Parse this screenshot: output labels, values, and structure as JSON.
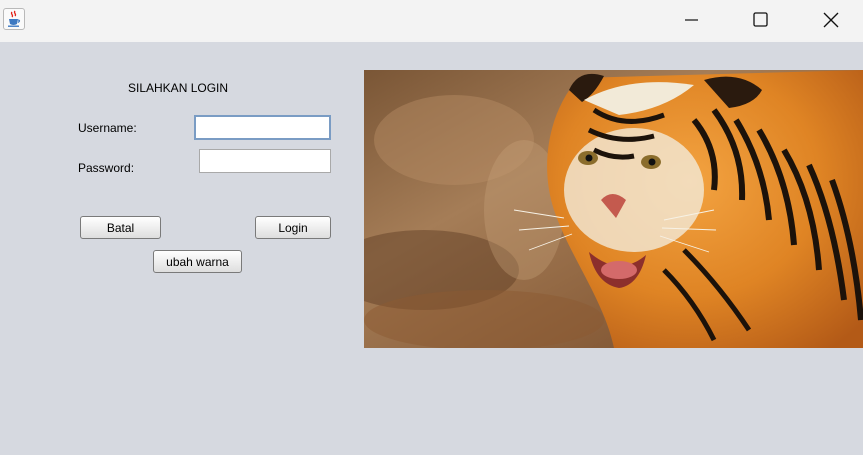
{
  "window": {
    "app_icon": "java-cup-icon",
    "controls": [
      "minimize-icon",
      "maximize-icon",
      "close-icon"
    ]
  },
  "form": {
    "title": "SILAHKAN LOGIN",
    "username_label": "Username:",
    "username_value": "",
    "password_label": "Password:",
    "password_value": "",
    "batal_label": "Batal",
    "login_label": "Login",
    "warna_label": "ubah warna"
  },
  "image": {
    "subject": "tiger-photo"
  },
  "colors": {
    "client_bg": "#d6d9e0",
    "titlebar_bg": "#f3f3f3",
    "focus_border": "#7a9cc4"
  }
}
